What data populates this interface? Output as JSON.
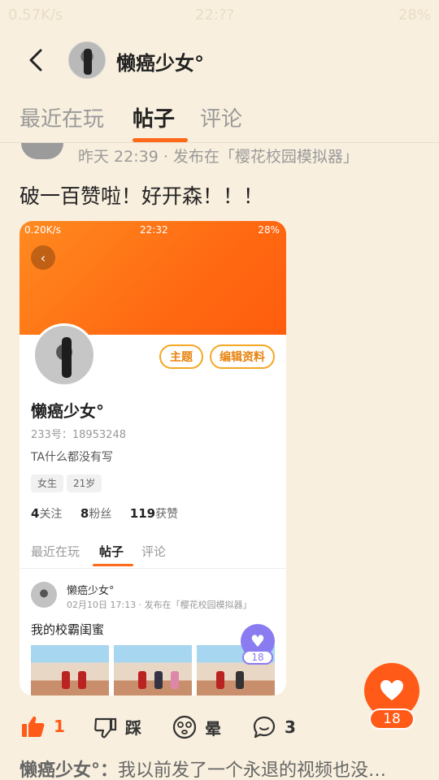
{
  "status_bar": {
    "left": "0.57K/s",
    "center": "22:??",
    "right": "28%"
  },
  "header": {
    "name": "懒癌少女°"
  },
  "tabs": [
    {
      "label": "最近在玩"
    },
    {
      "label": "帖子"
    },
    {
      "label": "评论"
    }
  ],
  "post": {
    "meta": "昨天 22:39 · 发布在「樱花校园模拟器」",
    "title": "破一百赞啦！好开森！！！"
  },
  "embedded": {
    "status_left": "0.20K/s",
    "status_center": "22:32",
    "status_right": "28%",
    "btn_theme": "主题",
    "btn_edit": "编辑资料",
    "name": "懒癌少女°",
    "id_line": "233号：18953248",
    "bio": "TA什么都没有写",
    "tags": [
      "女生",
      "21岁"
    ],
    "stats": {
      "follow_num": "4",
      "follow_label": "关注",
      "fans_num": "8",
      "fans_label": "粉丝",
      "likes_num": "119",
      "likes_label": "获赞"
    },
    "tabs": [
      "最近在玩",
      "帖子",
      "评论"
    ],
    "post_name": "懒癌少女°",
    "post_meta": "02月10日 17:13 · 发布在「樱花校园模拟器」",
    "post_title": "我的校霸闺蜜",
    "like_count": "18"
  },
  "like_fab": {
    "count": "18"
  },
  "actions": {
    "like_count": "1",
    "dislike_label": "踩",
    "dizzy_label": "晕",
    "comment_count": "3"
  },
  "comment": {
    "name": "懒癌少女°：",
    "text": "我以前发了一个永退的视频也没…"
  },
  "colors": {
    "accent": "#ff6a1a",
    "background": "#f8efde"
  }
}
